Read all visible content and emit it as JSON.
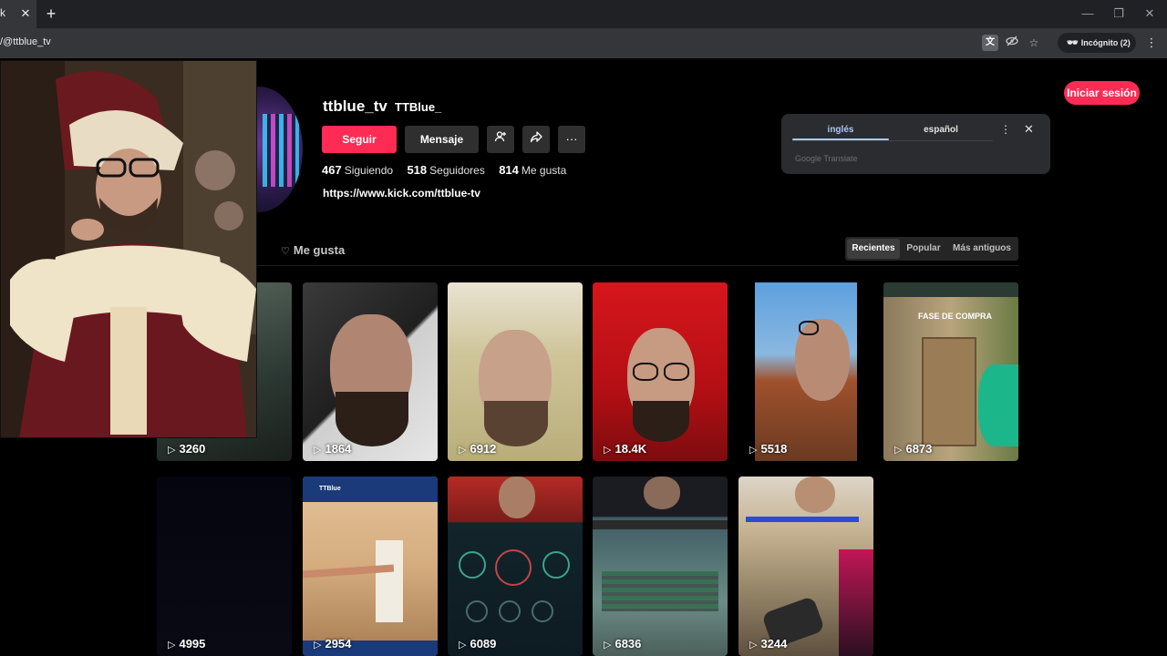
{
  "browser": {
    "tab_partial_text": "k",
    "tab_close": "✕",
    "new_tab": "+",
    "minimize": "—",
    "restore": "❐",
    "close": "✕",
    "url": "/@ttblue_tv",
    "incognito_label": "Incógnito (2)",
    "menu_icon": "⋮"
  },
  "translate": {
    "lang_from": "inglés",
    "lang_to": "español",
    "menu": "⋮",
    "close": "✕",
    "brand": "Google Translate"
  },
  "header": {
    "login_label": "Iniciar sesión"
  },
  "profile": {
    "username": "ttblue_tv",
    "nickname": "TTBlue_",
    "follow_label": "Seguir",
    "message_label": "Mensaje",
    "following_count": "467",
    "following_label": "Siguiendo",
    "followers_count": "518",
    "followers_label": "Seguidores",
    "likes_count": "814",
    "likes_label": "Me gusta",
    "bio_link": "https://www.kick.com/ttblue-tv"
  },
  "tabs": {
    "liked_label": "Me gusta"
  },
  "sort": {
    "options": [
      "Recientes",
      "Popular",
      "Más antiguos"
    ],
    "selected": "Recientes"
  },
  "videos": {
    "row1": [
      "3260",
      "1864",
      "6912",
      "18.4K",
      "5518",
      "6873"
    ],
    "row2": [
      "4995",
      "2954",
      "6089",
      "6836",
      "3244"
    ],
    "overlay_text": "FASE DE COMPRA",
    "overlay_text_2": "TTBlue"
  },
  "colors": {
    "accent": "#fe2c55",
    "chrome_dark": "#202124",
    "chrome_toolbar": "#35363a",
    "translate_blue": "#a8c7fa"
  }
}
